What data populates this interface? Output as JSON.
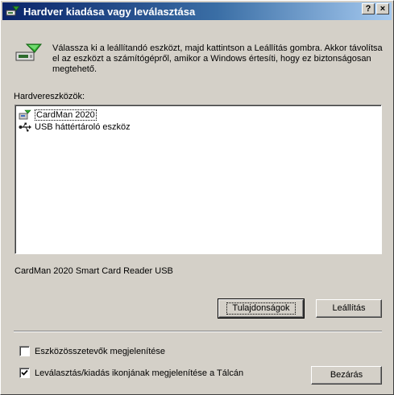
{
  "window": {
    "title": "Hardver kiadása vagy leválasztása",
    "help_label": "?",
    "close_label": "×",
    "colors": {
      "face": "#d4d0c8",
      "title_start": "#0a246a",
      "title_end": "#a6caf0"
    }
  },
  "intro": {
    "icon": "eject-hardware-icon",
    "text": "Válassza ki a leállítandó eszközt, majd kattintson a Leállítás gombra. Akkor távolítsa el az eszközt a számítógépről, amikor a Windows értesíti, hogy ez biztonságosan megtehető."
  },
  "devices": {
    "label": "Hardvereszközök:",
    "items": [
      {
        "label": "CardMan 2020",
        "icon": "smart-card-reader-icon",
        "selected": true
      },
      {
        "label": "USB háttértároló eszköz",
        "icon": "usb-icon",
        "selected": false
      }
    ],
    "selected_description": "CardMan 2020 Smart Card Reader USB"
  },
  "buttons": {
    "properties": "Tulajdonságok",
    "stop": "Leállítás",
    "close": "Bezárás"
  },
  "options": [
    {
      "label": "Eszközösszetevők megjelenítése",
      "checked": false
    },
    {
      "label": "Leválasztás/kiadás ikonjának megjelenítése a Tálcán",
      "checked": true
    }
  ]
}
